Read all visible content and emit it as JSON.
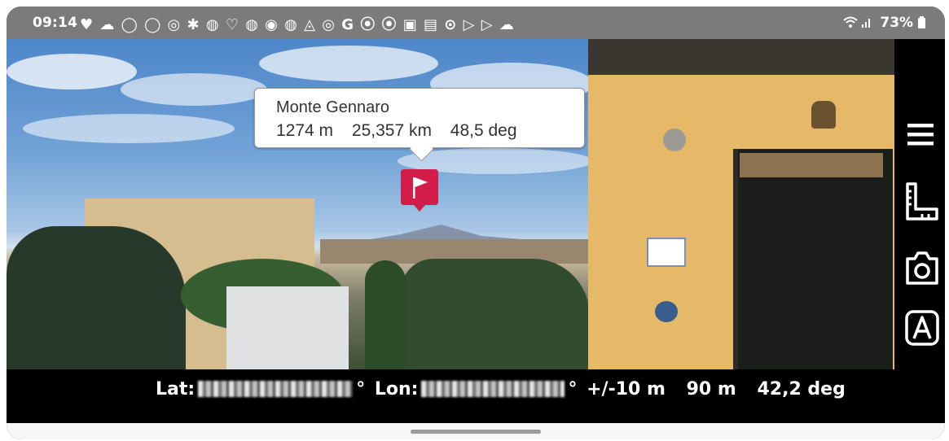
{
  "status_bar": {
    "time": "09:14",
    "notification_icons": "♥ ☁ ◯ ◯ ◎ ✱ ◍ ♡ ◍ ◉ ◍ ◬ ◎ G ⦿ ⦿ ▣ ▤ ⊙ ▷ ▷ ☁",
    "battery": "73%",
    "signal_icons": "wifi-icon signal-icon battery-icon"
  },
  "callout": {
    "peak_name": "Monte Gennaro",
    "altitude": "1274 m",
    "distance": "25,357 km",
    "bearing": "48,5 deg"
  },
  "marker": {
    "icon": "flag-icon",
    "color": "#d21d4b"
  },
  "sidebar": {
    "menu_icon": "menu-icon",
    "ruler_icon": "ruler-icon",
    "camera_icon": "camera-icon",
    "a_icon": "font-a-icon"
  },
  "info_bar": {
    "lat_label": "Lat:",
    "lat_suffix": "°",
    "lon_label": "Lon:",
    "lon_suffix": "°",
    "accuracy": "+/-10 m",
    "elevation": "90 m",
    "heading": "42,2 deg"
  }
}
